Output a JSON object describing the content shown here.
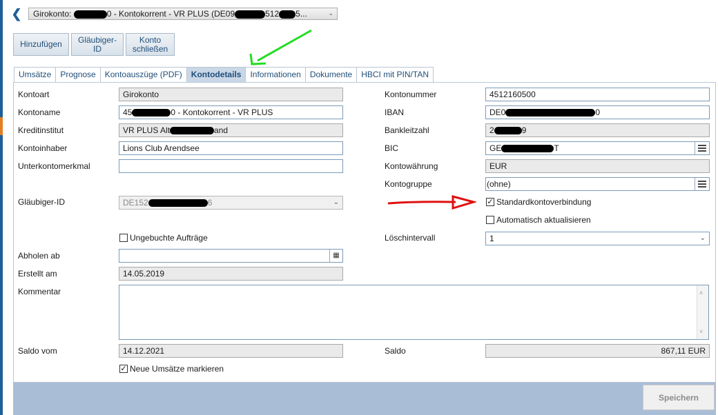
{
  "header": {
    "account_prefix": "Girokonto:",
    "account_mid": "0 - Kontokorrent - VR PLUS (DE09",
    "account_tail": "512",
    "account_end": "5..."
  },
  "toolbar": {
    "add_label": "Hinzufügen",
    "creditor_label": "Gläubiger-ID",
    "close_label": "Konto schließen"
  },
  "tabs": [
    "Umsätze",
    "Prognose",
    "Kontoauszüge (PDF)",
    "Kontodetails",
    "Informationen",
    "Dokumente",
    "HBCI mit PIN/TAN"
  ],
  "active_tab": "Kontodetails",
  "form": {
    "kontoart": {
      "label": "Kontoart",
      "value": "Girokonto"
    },
    "kontoname": {
      "label": "Kontoname",
      "prefix": "45",
      "suffix": "0 - Kontokorrent - VR PLUS"
    },
    "kreditinstitut": {
      "label": "Kreditinstitut",
      "prefix": "VR PLUS Alt",
      "suffix": "and"
    },
    "kontoinhaber": {
      "label": "Kontoinhaber",
      "value": "Lions Club Arendsee"
    },
    "unterkontomerkmal": {
      "label": "Unterkontomerkmal",
      "value": ""
    },
    "glaeubiger_id": {
      "label": "Gläubiger-ID",
      "prefix": "DE152",
      "suffix": "6"
    },
    "ungebuchte": {
      "label": "Ungebuchte Aufträge",
      "checked": false
    },
    "abholen_ab": {
      "label": "Abholen ab",
      "value": ""
    },
    "erstellt_am": {
      "label": "Erstellt am",
      "value": "14.05.2019"
    },
    "kommentar": {
      "label": "Kommentar",
      "value": ""
    },
    "saldo_vom": {
      "label": "Saldo vom",
      "value": "14.12.2021"
    },
    "neue_umsaetze": {
      "label": "Neue Umsätze markieren",
      "checked": true
    },
    "kontonummer": {
      "label": "Kontonummer",
      "value": "4512160500"
    },
    "iban": {
      "label": "IBAN",
      "prefix": "DE0",
      "suffix": "0"
    },
    "bankleitzahl": {
      "label": "Bankleitzahl",
      "prefix": "2",
      "suffix": "9"
    },
    "bic": {
      "label": "BIC",
      "prefix": "GE",
      "suffix": "T"
    },
    "kontowaehrung": {
      "label": "Kontowährung",
      "value": "EUR"
    },
    "kontogruppe": {
      "label": "Kontogruppe",
      "value": "(ohne)"
    },
    "standardkonto": {
      "label": "Standardkontoverbindung",
      "checked": true
    },
    "auto_update": {
      "label": "Automatisch aktualisieren",
      "checked": false
    },
    "loeschintervall": {
      "label": "Löschintervall",
      "value": "1"
    },
    "saldo": {
      "label": "Saldo",
      "value": "867,11 EUR"
    }
  },
  "footer": {
    "save_label": "Speichern"
  },
  "colors": {
    "accent": "#1f5f99",
    "footer_bar": "#aabdd7",
    "annotation_green": "#22dd22",
    "annotation_red": "#e01010"
  }
}
